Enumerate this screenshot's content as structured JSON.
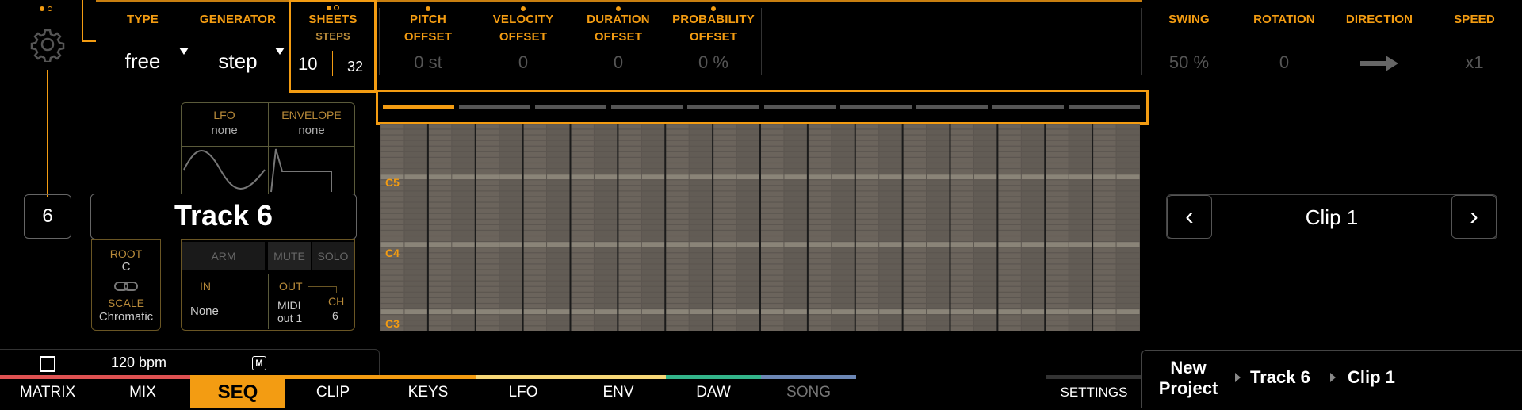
{
  "header": {
    "type": {
      "label": "TYPE",
      "value": "free"
    },
    "generator": {
      "label": "GENERATOR",
      "value": "step"
    },
    "sheets": {
      "label": "SHEETS",
      "sublabel": "STEPS",
      "value_left": "10",
      "value_right": "32"
    },
    "pitch": {
      "label1": "PITCH",
      "label2": "OFFSET",
      "value": "0 st"
    },
    "velocity": {
      "label1": "VELOCITY",
      "label2": "OFFSET",
      "value": "0"
    },
    "duration": {
      "label1": "DURATION",
      "label2": "OFFSET",
      "value": "0"
    },
    "probability": {
      "label1": "PROBABILITY",
      "label2": "OFFSET",
      "value": "0 %"
    },
    "swing": {
      "label": "SWING",
      "value": "50 %"
    },
    "rotation": {
      "label": "ROTATION",
      "value": "0"
    },
    "direction": {
      "label": "DIRECTION",
      "icon": "arrow-right-icon"
    },
    "speed": {
      "label": "SPEED",
      "value": "x1"
    }
  },
  "modulation": {
    "lfo": {
      "label": "LFO",
      "value": "none"
    },
    "envelope": {
      "label": "ENVELOPE",
      "value": "none"
    }
  },
  "track": {
    "number": "6",
    "name": "Track 6"
  },
  "scale": {
    "root_label": "ROOT",
    "root_value": "C",
    "scale_label": "SCALE",
    "scale_value": "Chromatic"
  },
  "track_controls": {
    "arm": "ARM",
    "mute": "MUTE",
    "solo": "SOLO",
    "in_label": "IN",
    "in_value": "None",
    "out_label": "OUT",
    "out_value": "MIDI out 1",
    "ch_label": "CH",
    "ch_value": "6"
  },
  "grid": {
    "note_labels": [
      "C5",
      "C4",
      "C3"
    ],
    "sheet_count": 10,
    "active_sheet": 0
  },
  "clip_nav": {
    "prev": "‹",
    "next": "›",
    "clip_name": "Clip 1"
  },
  "status": {
    "bpm": "120 bpm",
    "m_badge": "M"
  },
  "tabs": [
    "MATRIX",
    "MIX",
    "SEQ",
    "CLIP",
    "KEYS",
    "LFO",
    "ENV",
    "DAW",
    "SONG"
  ],
  "active_tab": "SEQ",
  "settings": "SETTINGS",
  "breadcrumb": {
    "project": "New Project",
    "track": "Track 6",
    "clip": "Clip 1"
  },
  "colors": {
    "accent": "#f39c12",
    "strip": [
      "#e05252",
      "#f39c12",
      "#f7d878",
      "#33b58a",
      "#6c87b5"
    ]
  }
}
